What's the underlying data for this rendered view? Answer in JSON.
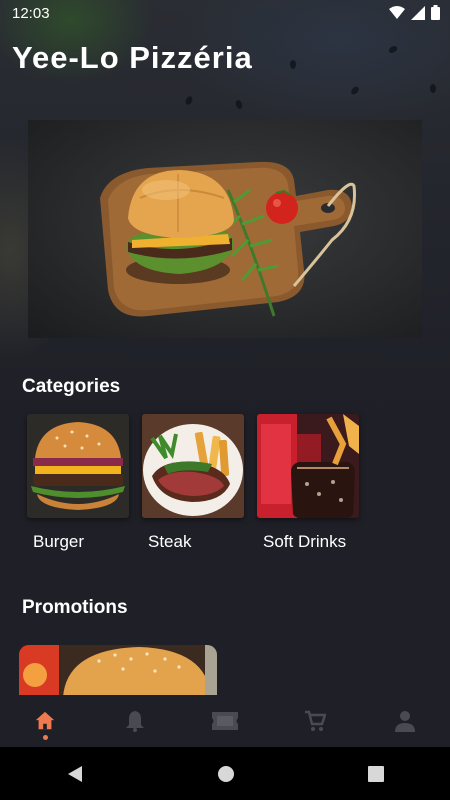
{
  "status_bar": {
    "time": "12:03"
  },
  "app": {
    "title": "Yee-Lo Pizzéria"
  },
  "sections": {
    "categories_title": "Categories",
    "promotions_title": "Promotions"
  },
  "categories": [
    {
      "label": "Burger"
    },
    {
      "label": "Steak"
    },
    {
      "label": "Soft Drinks"
    }
  ],
  "bottom_nav": {
    "items": [
      {
        "icon": "home-icon",
        "active": true
      },
      {
        "icon": "bell-icon",
        "active": false
      },
      {
        "icon": "ticket-icon",
        "active": false
      },
      {
        "icon": "cart-icon",
        "active": false
      },
      {
        "icon": "person-icon",
        "active": false
      }
    ]
  },
  "colors": {
    "background": "#1f2027",
    "accent": "#f07a4f",
    "inactive_icon": "#4a4b52"
  }
}
